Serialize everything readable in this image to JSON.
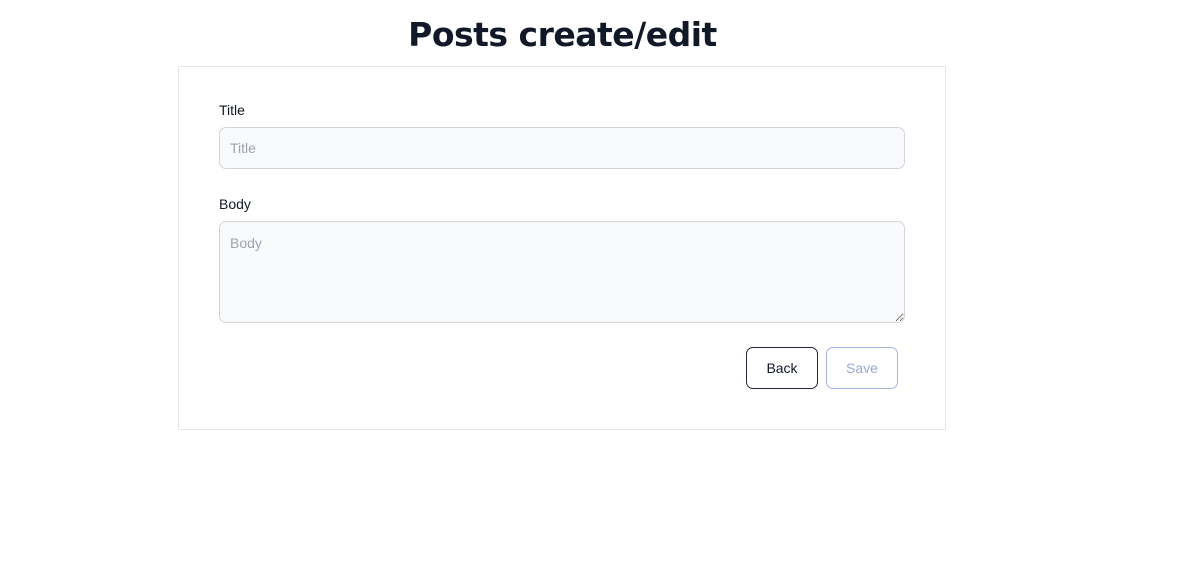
{
  "page": {
    "title": "Posts create/edit"
  },
  "form": {
    "title_field": {
      "label": "Title",
      "placeholder": "Title",
      "value": ""
    },
    "body_field": {
      "label": "Body",
      "placeholder": "Body",
      "value": ""
    },
    "buttons": {
      "back_label": "Back",
      "save_label": "Save",
      "save_disabled": true
    }
  },
  "colors": {
    "text": "#111827",
    "border": "#e5e7eb",
    "input_bg": "#f9fafb",
    "placeholder": "#9ca3af",
    "save_disabled": "#a5b4e6"
  }
}
